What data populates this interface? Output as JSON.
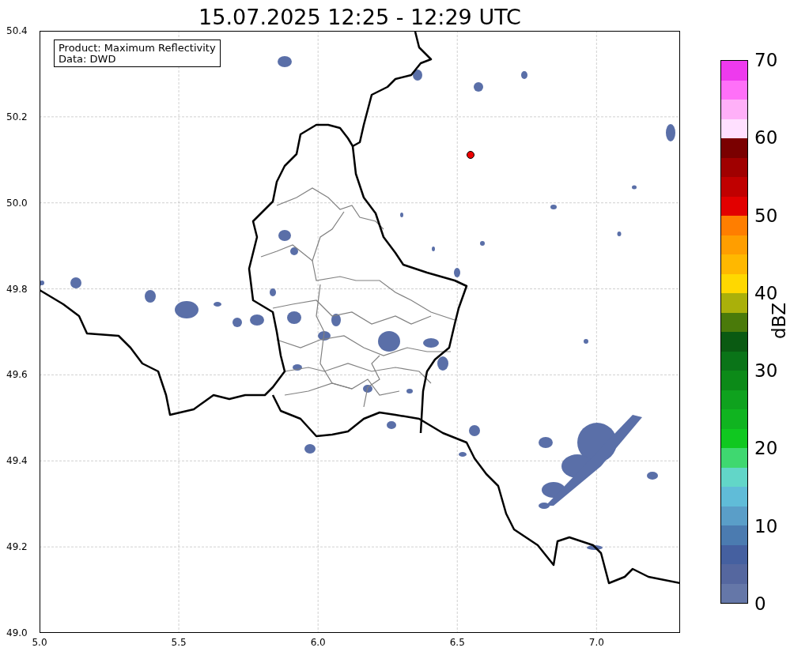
{
  "title": "15.07.2025 12:25 - 12:29 UTC",
  "map": {
    "info_box": [
      "Product: Maximum Reflectivity",
      "Data: DWD"
    ],
    "x_ticks": [
      "5.0",
      "5.5",
      "6.0",
      "6.5",
      "7.0"
    ],
    "y_ticks": [
      "50.4",
      "50.2",
      "50.0",
      "49.8",
      "49.6",
      "49.4",
      "49.2",
      "49.0"
    ]
  },
  "colorbar": {
    "label": "dBZ",
    "ticks": [
      "70",
      "60",
      "50",
      "40",
      "30",
      "20",
      "10",
      "0"
    ],
    "segments": [
      {
        "color": "#ee3aee"
      },
      {
        "color": "#ff70f8"
      },
      {
        "color": "#ffb0f8"
      },
      {
        "color": "#ffe0ff"
      },
      {
        "color": "#7a0000"
      },
      {
        "color": "#a00000"
      },
      {
        "color": "#c00000"
      },
      {
        "color": "#e20000"
      },
      {
        "color": "#ff7e00"
      },
      {
        "color": "#ff9e00"
      },
      {
        "color": "#ffb800"
      },
      {
        "color": "#ffd800"
      },
      {
        "color": "#aab00a"
      },
      {
        "color": "#4a7a0a"
      },
      {
        "color": "#0a5a12"
      },
      {
        "color": "#0a7418"
      },
      {
        "color": "#0c8a18"
      },
      {
        "color": "#0fa21e"
      },
      {
        "color": "#10b420"
      },
      {
        "color": "#10c820"
      },
      {
        "color": "#3fd870"
      },
      {
        "color": "#62d6c8"
      },
      {
        "color": "#60bcd8"
      },
      {
        "color": "#5a9ec8"
      },
      {
        "color": "#4b7bb0"
      },
      {
        "color": "#4560a0"
      },
      {
        "color": "#55679f"
      },
      {
        "color": "#6577a8"
      }
    ]
  }
}
